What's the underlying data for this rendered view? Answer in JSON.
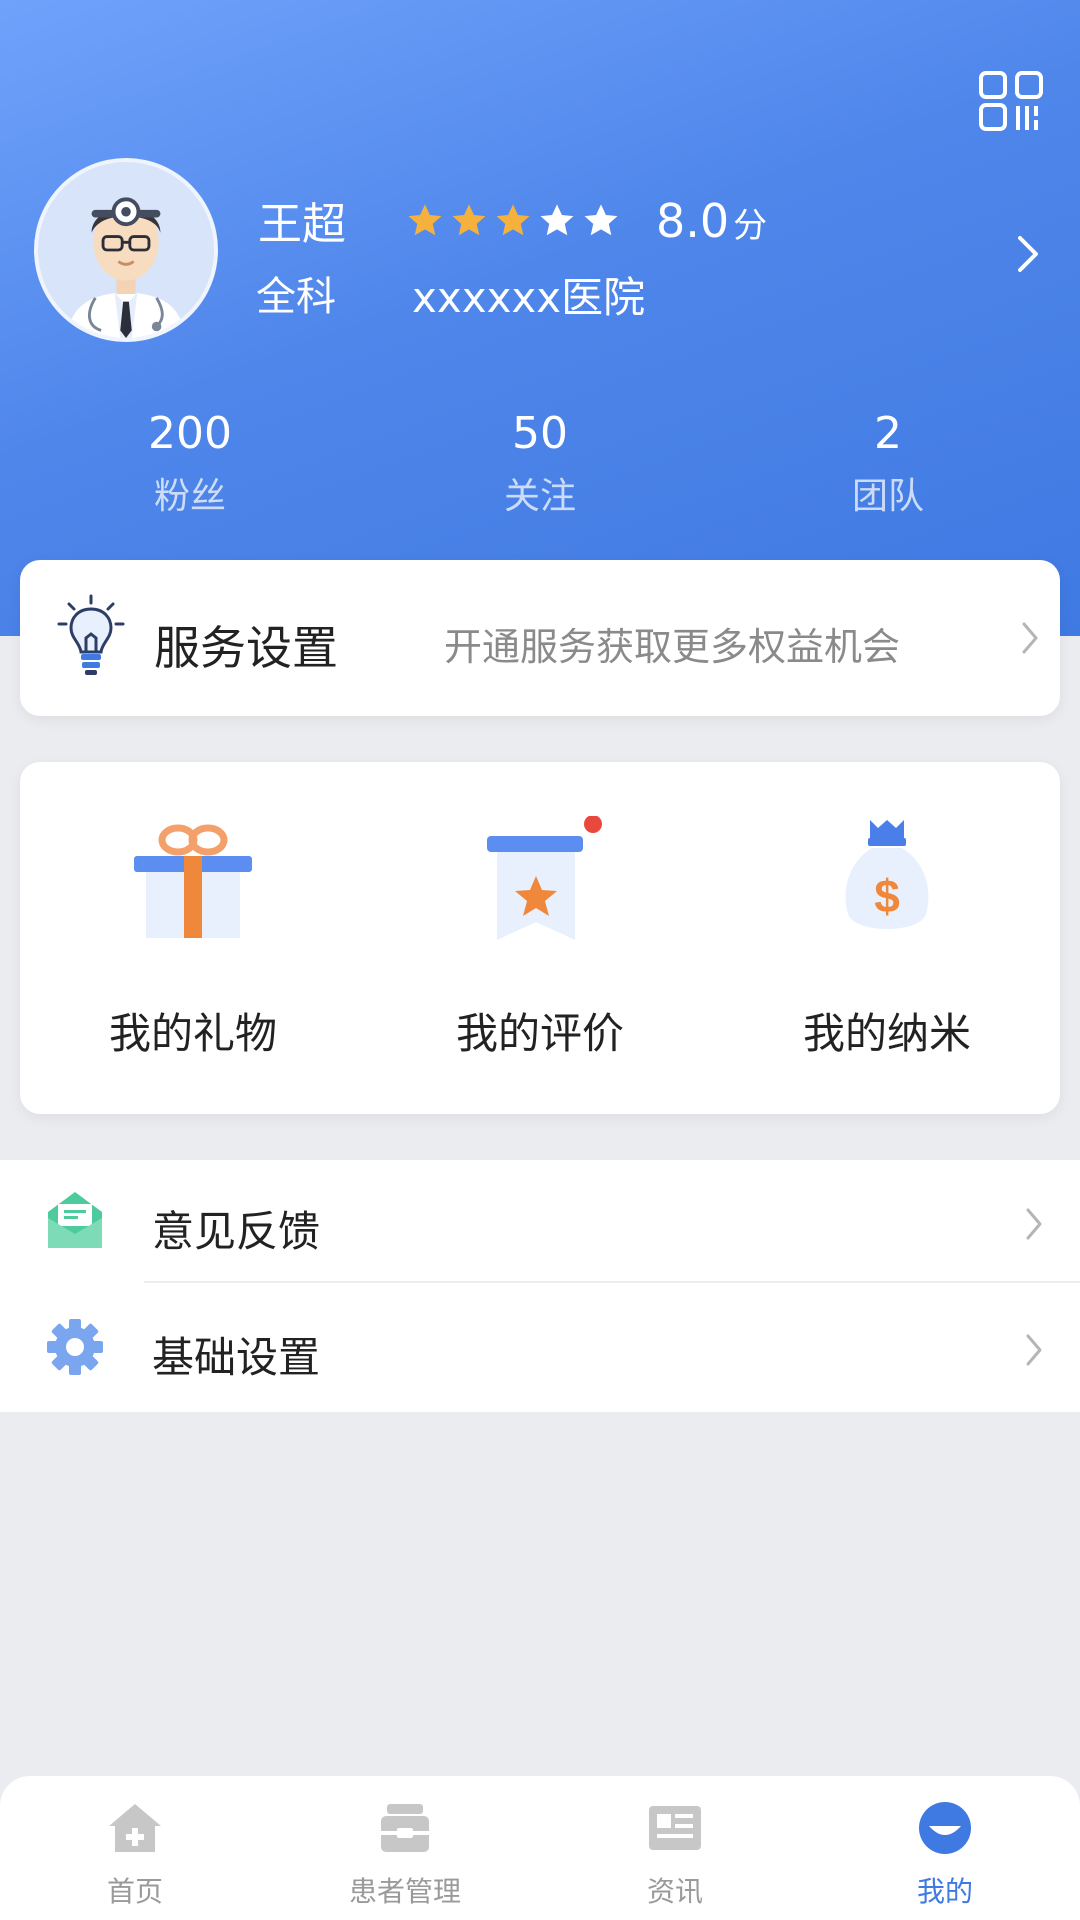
{
  "profile": {
    "name": "王超",
    "department": "全科",
    "hospital": "xxxxxx医院",
    "rating": {
      "stars_filled": 3,
      "stars_total": 5,
      "score": "8.0",
      "unit": "分"
    }
  },
  "stats": [
    {
      "value": "200",
      "label": "粉丝"
    },
    {
      "value": "50",
      "label": "关注"
    },
    {
      "value": "2",
      "label": "团队"
    }
  ],
  "service": {
    "title": "服务设置",
    "subtitle": "开通服务获取更多权益机会"
  },
  "features": [
    {
      "label": "我的礼物",
      "icon": "gift-icon"
    },
    {
      "label": "我的评价",
      "icon": "review-ribbon-icon",
      "badge": true
    },
    {
      "label": "我的纳米",
      "icon": "money-bag-icon"
    }
  ],
  "menu": [
    {
      "label": "意见反馈",
      "icon": "mail-envelope-icon"
    },
    {
      "label": "基础设置",
      "icon": "gear-icon"
    }
  ],
  "tabs": [
    {
      "label": "首页",
      "icon": "home-icon",
      "active": false
    },
    {
      "label": "患者管理",
      "icon": "patient-box-icon",
      "active": false
    },
    {
      "label": "资讯",
      "icon": "news-icon",
      "active": false
    },
    {
      "label": "我的",
      "icon": "profile-face-icon",
      "active": true
    }
  ],
  "colors": {
    "primary": "#3f79e2",
    "star_filled": "#f5b13d",
    "star_empty": "#ffffff",
    "badge": "#e9483d"
  }
}
